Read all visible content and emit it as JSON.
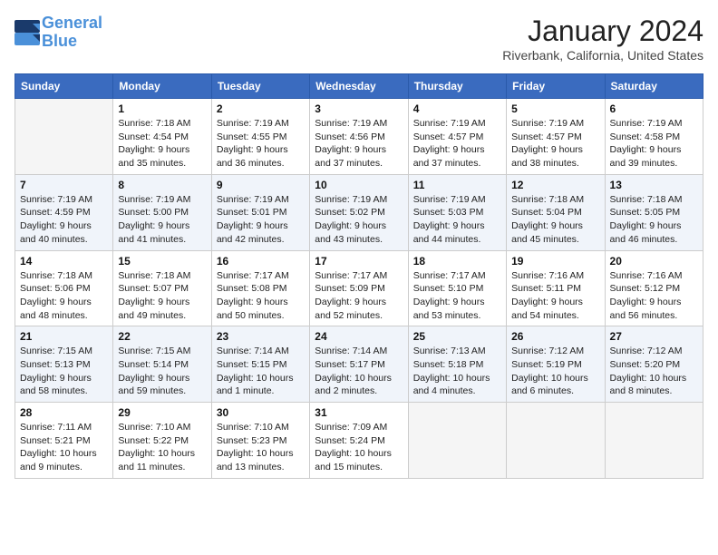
{
  "header": {
    "logo_line1": "General",
    "logo_line2": "Blue",
    "month_title": "January 2024",
    "location": "Riverbank, California, United States"
  },
  "weekdays": [
    "Sunday",
    "Monday",
    "Tuesday",
    "Wednesday",
    "Thursday",
    "Friday",
    "Saturday"
  ],
  "weeks": [
    [
      {
        "day": "",
        "info": ""
      },
      {
        "day": "1",
        "info": "Sunrise: 7:18 AM\nSunset: 4:54 PM\nDaylight: 9 hours\nand 35 minutes."
      },
      {
        "day": "2",
        "info": "Sunrise: 7:19 AM\nSunset: 4:55 PM\nDaylight: 9 hours\nand 36 minutes."
      },
      {
        "day": "3",
        "info": "Sunrise: 7:19 AM\nSunset: 4:56 PM\nDaylight: 9 hours\nand 37 minutes."
      },
      {
        "day": "4",
        "info": "Sunrise: 7:19 AM\nSunset: 4:57 PM\nDaylight: 9 hours\nand 37 minutes."
      },
      {
        "day": "5",
        "info": "Sunrise: 7:19 AM\nSunset: 4:57 PM\nDaylight: 9 hours\nand 38 minutes."
      },
      {
        "day": "6",
        "info": "Sunrise: 7:19 AM\nSunset: 4:58 PM\nDaylight: 9 hours\nand 39 minutes."
      }
    ],
    [
      {
        "day": "7",
        "info": "Sunrise: 7:19 AM\nSunset: 4:59 PM\nDaylight: 9 hours\nand 40 minutes."
      },
      {
        "day": "8",
        "info": "Sunrise: 7:19 AM\nSunset: 5:00 PM\nDaylight: 9 hours\nand 41 minutes."
      },
      {
        "day": "9",
        "info": "Sunrise: 7:19 AM\nSunset: 5:01 PM\nDaylight: 9 hours\nand 42 minutes."
      },
      {
        "day": "10",
        "info": "Sunrise: 7:19 AM\nSunset: 5:02 PM\nDaylight: 9 hours\nand 43 minutes."
      },
      {
        "day": "11",
        "info": "Sunrise: 7:19 AM\nSunset: 5:03 PM\nDaylight: 9 hours\nand 44 minutes."
      },
      {
        "day": "12",
        "info": "Sunrise: 7:18 AM\nSunset: 5:04 PM\nDaylight: 9 hours\nand 45 minutes."
      },
      {
        "day": "13",
        "info": "Sunrise: 7:18 AM\nSunset: 5:05 PM\nDaylight: 9 hours\nand 46 minutes."
      }
    ],
    [
      {
        "day": "14",
        "info": "Sunrise: 7:18 AM\nSunset: 5:06 PM\nDaylight: 9 hours\nand 48 minutes."
      },
      {
        "day": "15",
        "info": "Sunrise: 7:18 AM\nSunset: 5:07 PM\nDaylight: 9 hours\nand 49 minutes."
      },
      {
        "day": "16",
        "info": "Sunrise: 7:17 AM\nSunset: 5:08 PM\nDaylight: 9 hours\nand 50 minutes."
      },
      {
        "day": "17",
        "info": "Sunrise: 7:17 AM\nSunset: 5:09 PM\nDaylight: 9 hours\nand 52 minutes."
      },
      {
        "day": "18",
        "info": "Sunrise: 7:17 AM\nSunset: 5:10 PM\nDaylight: 9 hours\nand 53 minutes."
      },
      {
        "day": "19",
        "info": "Sunrise: 7:16 AM\nSunset: 5:11 PM\nDaylight: 9 hours\nand 54 minutes."
      },
      {
        "day": "20",
        "info": "Sunrise: 7:16 AM\nSunset: 5:12 PM\nDaylight: 9 hours\nand 56 minutes."
      }
    ],
    [
      {
        "day": "21",
        "info": "Sunrise: 7:15 AM\nSunset: 5:13 PM\nDaylight: 9 hours\nand 58 minutes."
      },
      {
        "day": "22",
        "info": "Sunrise: 7:15 AM\nSunset: 5:14 PM\nDaylight: 9 hours\nand 59 minutes."
      },
      {
        "day": "23",
        "info": "Sunrise: 7:14 AM\nSunset: 5:15 PM\nDaylight: 10 hours\nand 1 minute."
      },
      {
        "day": "24",
        "info": "Sunrise: 7:14 AM\nSunset: 5:17 PM\nDaylight: 10 hours\nand 2 minutes."
      },
      {
        "day": "25",
        "info": "Sunrise: 7:13 AM\nSunset: 5:18 PM\nDaylight: 10 hours\nand 4 minutes."
      },
      {
        "day": "26",
        "info": "Sunrise: 7:12 AM\nSunset: 5:19 PM\nDaylight: 10 hours\nand 6 minutes."
      },
      {
        "day": "27",
        "info": "Sunrise: 7:12 AM\nSunset: 5:20 PM\nDaylight: 10 hours\nand 8 minutes."
      }
    ],
    [
      {
        "day": "28",
        "info": "Sunrise: 7:11 AM\nSunset: 5:21 PM\nDaylight: 10 hours\nand 9 minutes."
      },
      {
        "day": "29",
        "info": "Sunrise: 7:10 AM\nSunset: 5:22 PM\nDaylight: 10 hours\nand 11 minutes."
      },
      {
        "day": "30",
        "info": "Sunrise: 7:10 AM\nSunset: 5:23 PM\nDaylight: 10 hours\nand 13 minutes."
      },
      {
        "day": "31",
        "info": "Sunrise: 7:09 AM\nSunset: 5:24 PM\nDaylight: 10 hours\nand 15 minutes."
      },
      {
        "day": "",
        "info": ""
      },
      {
        "day": "",
        "info": ""
      },
      {
        "day": "",
        "info": ""
      }
    ]
  ]
}
